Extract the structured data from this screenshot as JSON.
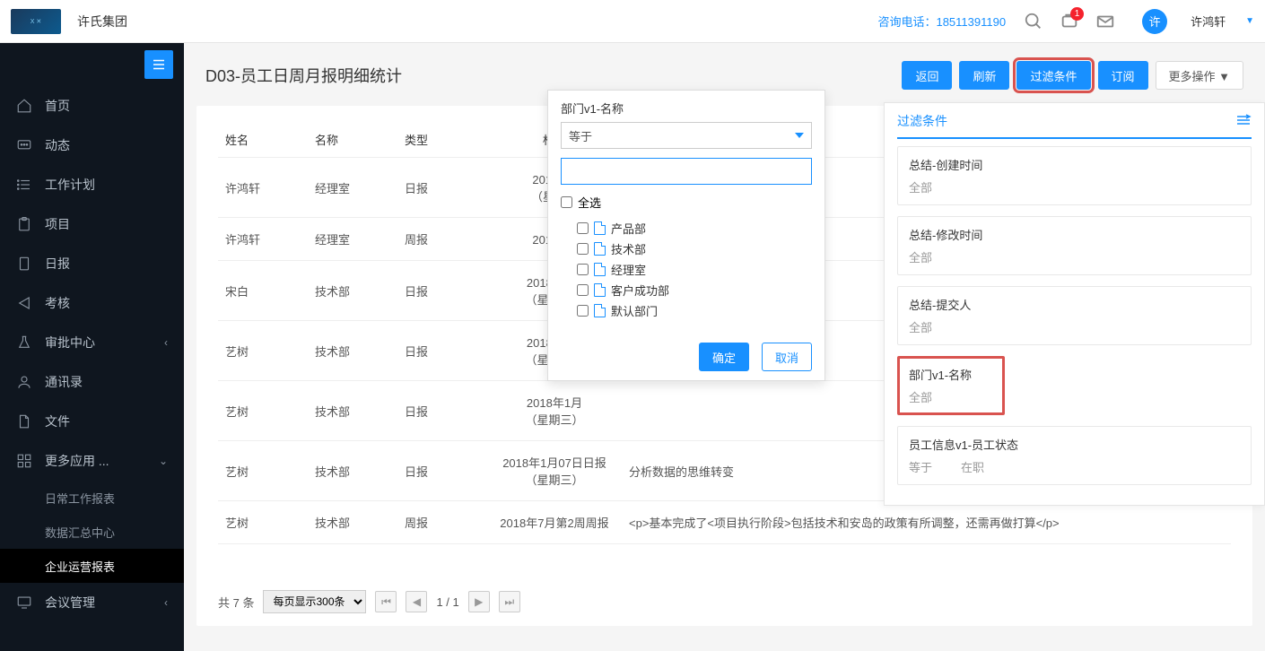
{
  "header": {
    "company": "许氏集团",
    "contact_label": "咨询电话：",
    "contact_number": "18511391190",
    "avatar_letter": "许",
    "username": "许鸿轩",
    "notification_count": "1"
  },
  "sidebar": {
    "items": [
      {
        "label": "首页",
        "icon": "home"
      },
      {
        "label": "动态",
        "icon": "chat"
      },
      {
        "label": "工作计划",
        "icon": "list"
      },
      {
        "label": "项目",
        "icon": "clipboard"
      },
      {
        "label": "日报",
        "icon": "doc"
      },
      {
        "label": "考核",
        "icon": "share"
      },
      {
        "label": "审批中心",
        "icon": "flask",
        "chevron": true
      },
      {
        "label": "通讯录",
        "icon": "user"
      },
      {
        "label": "文件",
        "icon": "file"
      },
      {
        "label": "更多应用 ...",
        "icon": "grid",
        "chevron_down": true,
        "children": [
          {
            "label": "日常工作报表"
          },
          {
            "label": "数据汇总中心"
          },
          {
            "label": "企业运营报表",
            "active": true
          }
        ]
      },
      {
        "label": "会议管理",
        "icon": "monitor",
        "chevron": true
      }
    ]
  },
  "page": {
    "title": "D03-员工日周月报明细统计",
    "buttons": {
      "back": "返回",
      "refresh": "刷新",
      "filter": "过滤条件",
      "subscribe": "订阅",
      "more": "更多操作 ▼"
    }
  },
  "table": {
    "headers": {
      "name": "姓名",
      "dept": "名称",
      "type": "类型",
      "title": "标题",
      "summary": ""
    },
    "rows": [
      {
        "name": "许鸿轩",
        "dept": "经理室",
        "type": "日报",
        "title": "2018年1\n（星期四",
        "summary": ""
      },
      {
        "name": "许鸿轩",
        "dept": "经理室",
        "type": "周报",
        "title": "2018年7",
        "summary": ""
      },
      {
        "name": "宋白",
        "dept": "技术部",
        "type": "日报",
        "title": "2018年1月\n（星期四）",
        "summary": ""
      },
      {
        "name": "艺树",
        "dept": "技术部",
        "type": "日报",
        "title": "2018年1月\n（星期二）",
        "summary": ""
      },
      {
        "name": "艺树",
        "dept": "技术部",
        "type": "日报",
        "title": "2018年1月\n（星期三）",
        "summary": ""
      },
      {
        "name": "艺树",
        "dept": "技术部",
        "type": "日报",
        "title": "2018年1月07日日报\n（星期三）",
        "summary": "分析数据的思维转变"
      },
      {
        "name": "艺树",
        "dept": "技术部",
        "type": "周报",
        "title": "2018年7月第2周周报",
        "summary": "<p>基本完成了&lt;项目执行阶段>包括技术和安岛的政策有所调整，还需再做打算</p>"
      }
    ]
  },
  "pagination": {
    "total_label": "共 7 条",
    "page_size": "每页显示300条",
    "pages": "1 / 1"
  },
  "popover": {
    "title": "部门v1-名称",
    "operator": "等于",
    "select_all": "全选",
    "options": [
      "产品部",
      "技术部",
      "经理室",
      "客户成功部",
      "默认部门"
    ],
    "ok": "确定",
    "cancel": "取消"
  },
  "filter_panel": {
    "title": "过滤条件",
    "cards": [
      {
        "title": "总结-创建时间",
        "value": "全部"
      },
      {
        "title": "总结-修改时间",
        "value": "全部"
      },
      {
        "title": "总结-提交人",
        "value": "全部"
      },
      {
        "title": "部门v1-名称",
        "value": "全部",
        "highlight": true
      },
      {
        "title": "员工信息v1-员工状态",
        "value": "等于",
        "val2": "在职"
      }
    ]
  }
}
